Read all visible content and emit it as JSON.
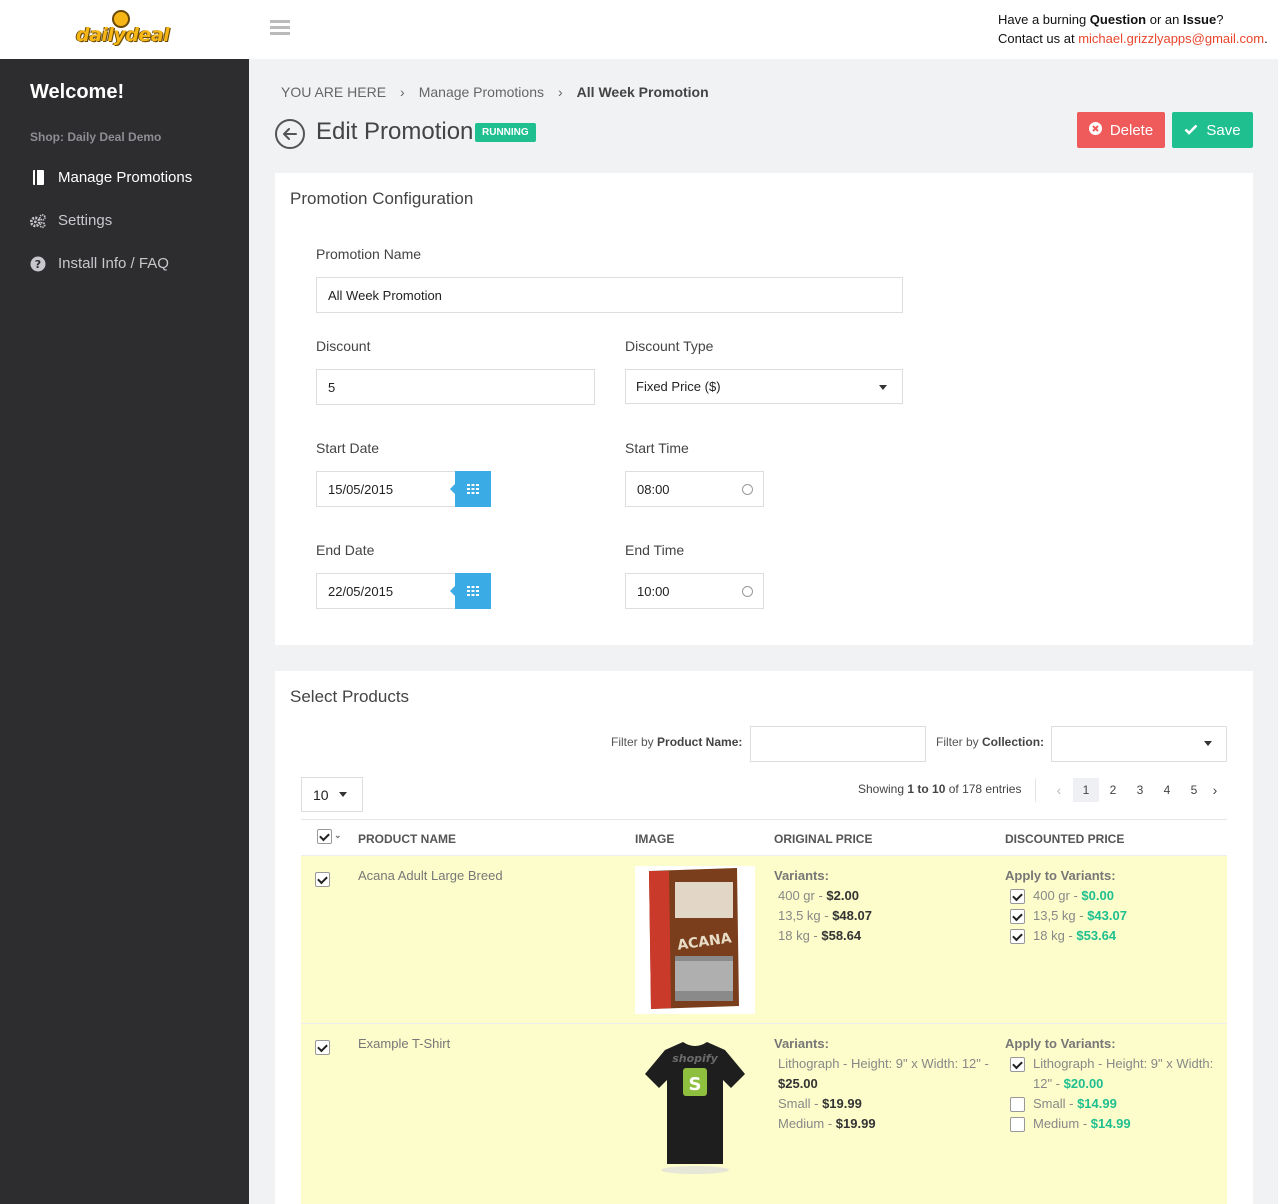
{
  "header": {
    "logo_text": "dailydeal",
    "contact_line1_pre": "Have a burning ",
    "contact_line1_b1": "Question",
    "contact_line1_mid": " or an ",
    "contact_line1_b2": "Issue",
    "contact_line1_post": "?",
    "contact_line2_pre": "Contact us at ",
    "contact_email": "michael.grizzlyapps@gmail.com",
    "contact_line2_post": "."
  },
  "sidebar": {
    "welcome": "Welcome!",
    "shop": "Shop: Daily Deal Demo",
    "items": [
      {
        "label": "Manage Promotions",
        "icon": "book-icon"
      },
      {
        "label": "Settings",
        "icon": "gears-icon"
      },
      {
        "label": "Install Info / FAQ",
        "icon": "question-circle-icon"
      }
    ]
  },
  "breadcrumb": {
    "root": "YOU ARE HERE",
    "level1": "Manage Promotions",
    "current": "All Week Promotion",
    "separator": "›"
  },
  "page": {
    "title": "Edit Promotion",
    "status": "RUNNING",
    "delete_label": "Delete",
    "save_label": "Save"
  },
  "config": {
    "title": "Promotion Configuration",
    "name_label": "Promotion Name",
    "name_value": "All Week Promotion",
    "discount_label": "Discount",
    "discount_value": "5",
    "discount_type_label": "Discount Type",
    "discount_type_value": "Fixed Price ($)",
    "start_date_label": "Start Date",
    "start_date_value": "15/05/2015",
    "start_time_label": "Start Time",
    "start_time_value": "08:00",
    "end_date_label": "End Date",
    "end_date_value": "22/05/2015",
    "end_time_label": "End Time",
    "end_time_value": "10:00"
  },
  "products": {
    "title": "Select Products",
    "filter_name_pre": "Filter by ",
    "filter_name_b": "Product Name:",
    "filter_collection_pre": "Filter by ",
    "filter_collection_b": "Collection:",
    "page_size": "10",
    "showing_pre": "Showing ",
    "showing_range": "1 to 10",
    "showing_mid": " of 178 entries",
    "pages": [
      "1",
      "2",
      "3",
      "4",
      "5"
    ],
    "active_page": "1",
    "columns": {
      "name": "PRODUCT NAME",
      "image": "IMAGE",
      "original": "ORIGINAL PRICE",
      "discounted": "DISCOUNTED PRICE"
    },
    "variants_heading": "Variants:",
    "apply_heading": "Apply to Variants:",
    "rows": [
      {
        "name": "Acana Adult Large Breed",
        "checked": true,
        "image_text": "ACANA",
        "variants": [
          {
            "label": "400 gr - ",
            "price": "$2.00"
          },
          {
            "label": "13,5 kg - ",
            "price": "$48.07"
          },
          {
            "label": "18 kg - ",
            "price": "$58.64"
          }
        ],
        "apply": [
          {
            "label": "400 gr - ",
            "price": "$0.00",
            "checked": true
          },
          {
            "label": "13,5 kg - ",
            "price": "$43.07",
            "checked": true
          },
          {
            "label": "18 kg - ",
            "price": "$53.64",
            "checked": true
          }
        ]
      },
      {
        "name": "Example T-Shirt",
        "checked": true,
        "image_text": "shopify",
        "variants": [
          {
            "label": "Lithograph - Height: 9\" x Width: 12\" - ",
            "price": "$25.00"
          },
          {
            "label": "Small - ",
            "price": "$19.99"
          },
          {
            "label": "Medium - ",
            "price": "$19.99"
          }
        ],
        "apply": [
          {
            "label": "Lithograph - Height: 9\" x Width: 12\" - ",
            "price": "$20.00",
            "checked": true
          },
          {
            "label": "Small - ",
            "price": "$14.99",
            "checked": false
          },
          {
            "label": "Medium - ",
            "price": "$14.99",
            "checked": false
          }
        ]
      }
    ]
  },
  "colors": {
    "sidebar": "#2d2d30",
    "accent_green": "#1fbf8f",
    "danger": "#ef5a5a",
    "calendar_blue": "#3aabe4",
    "row_highlight": "#fdfdcb"
  }
}
